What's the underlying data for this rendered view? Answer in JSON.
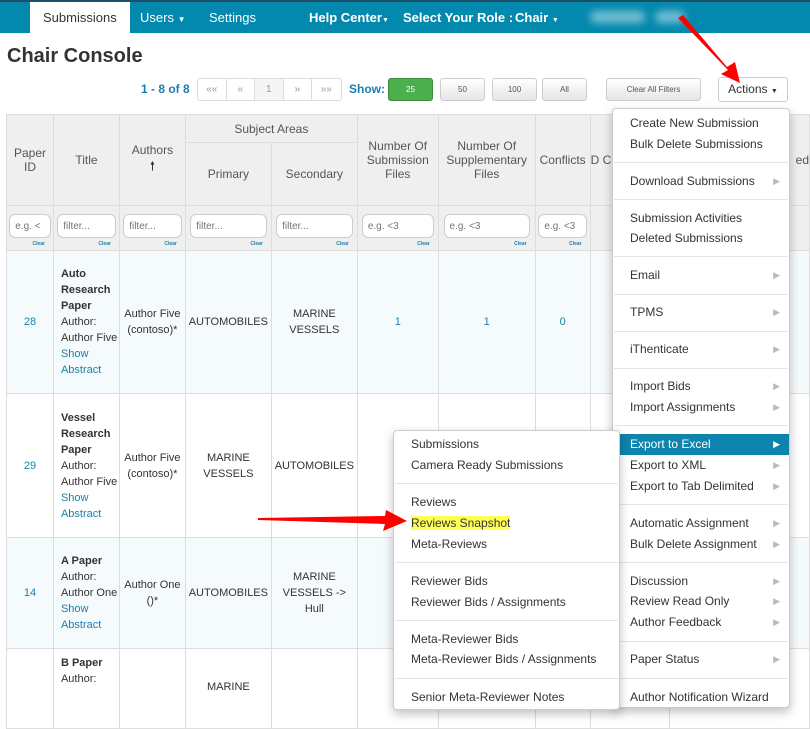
{
  "nav": {
    "tabs": [
      "Submissions",
      "Users",
      "Settings"
    ],
    "help": "Help Center",
    "role_label": "Select Your Role :",
    "role": "Chair"
  },
  "page_title": "Chair Console",
  "pagination": {
    "summary": "1 - 8 of 8",
    "first": "««",
    "prev": "«",
    "page": "1",
    "next": "»",
    "last": "»»",
    "show_label": "Show:",
    "sizes": [
      "25",
      "50",
      "100",
      "All"
    ],
    "selected_size": "25",
    "clear_filters": "Clear All Filters",
    "actions": "Actions"
  },
  "table": {
    "headers": {
      "paper_id": "Paper ID",
      "title": "Title",
      "authors": "Authors",
      "subject_areas": "Subject Areas",
      "primary": "Primary",
      "secondary": "Secondary",
      "sub_files": "Number Of Submission Files",
      "supp_files": "Number Of Supplementary Files",
      "conflicts": "Conflicts",
      "partial_d": "D C",
      "partial_ed": "ed"
    },
    "filters": [
      "e.g. <",
      "filter...",
      "filter...",
      "filter...",
      "filter...",
      "e.g. <3",
      "e.g. <3",
      "e.g. <3"
    ],
    "clear_label": "Clear",
    "rows": [
      {
        "id": "28",
        "title": "Auto Research Paper",
        "author_label": "Author:",
        "author": "Author Five",
        "link": "Show Abstract",
        "authors": "Author Five (contoso)*",
        "primary": "AUTOMOBILES",
        "secondary": "MARINE VESSELS",
        "sub": "1",
        "supp": "1",
        "conflicts": "0"
      },
      {
        "id": "29",
        "title": "Vessel Research Paper",
        "author_label": "Author:",
        "author": "Author Five",
        "link": "Show Abstract",
        "authors": "Author Five (contoso)*",
        "primary": "MARINE VESSELS",
        "secondary": "AUTOMOBILES"
      },
      {
        "id": "14",
        "title": "A Paper",
        "author_label": "Author:",
        "author": "Author One",
        "link": "Show Abstract",
        "authors": "Author One ()*",
        "primary": "AUTOMOBILES",
        "secondary": "MARINE VESSELS -> Hull"
      },
      {
        "title": "B Paper",
        "author_label": "Author:",
        "primary": "MARINE"
      }
    ]
  },
  "actions_menu": [
    "Create New Submission",
    "Bulk Delete Submissions",
    "Download Submissions",
    "Submission Activities",
    "Deleted Submissions",
    "Email",
    "TPMS",
    "iThenticate",
    "Import Bids",
    "Import Assignments",
    "Export to Excel",
    "Export to XML",
    "Export to Tab Delimited",
    "Automatic Assignment",
    "Bulk Delete Assignment",
    "Discussion",
    "Review Read Only",
    "Author Feedback",
    "Paper Status",
    "Author Notification Wizard"
  ],
  "export_submenu": [
    "Submissions",
    "Camera Ready Submissions",
    "Reviews",
    "Reviews Snapshot",
    "Meta-Reviews",
    "Reviewer Bids",
    "Reviewer Bids / Assignments",
    "Meta-Reviewer Bids",
    "Meta-Reviewer Bids / Assignments",
    "Senior Meta-Reviewer Notes"
  ],
  "colors": {
    "nav": "#0389ad",
    "link": "#1a7fad",
    "green": "#4cae4c",
    "highlight": "#0c84ad",
    "annotation": "#ff0000",
    "marker": "#ffff55"
  }
}
